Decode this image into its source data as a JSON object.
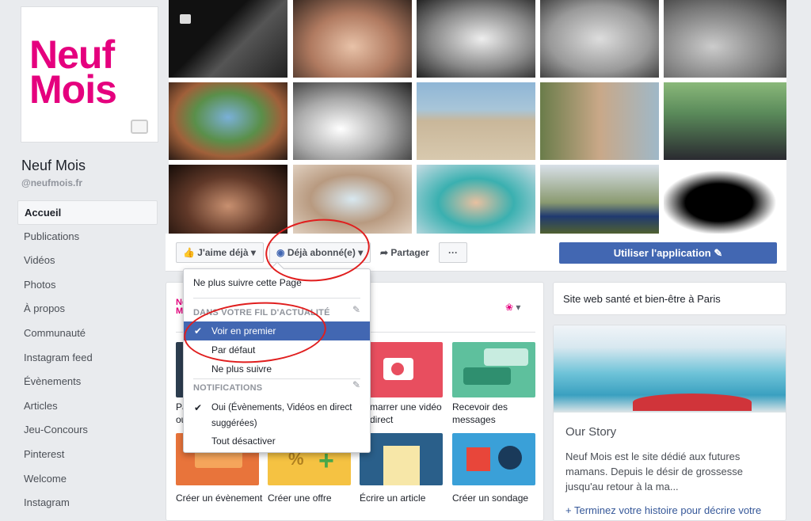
{
  "page": {
    "name": "Neuf Mois",
    "handle": "@neufmois.fr",
    "logo_line1": "Neuf",
    "logo_line2": "Mois"
  },
  "nav": [
    "Accueil",
    "Publications",
    "Vidéos",
    "Photos",
    "À propos",
    "Communauté",
    "Instagram feed",
    "Évènements",
    "Articles",
    "Jeu-Concours",
    "Pinterest",
    "Welcome",
    "Instagram"
  ],
  "actions": {
    "like": "J'aime déjà",
    "subscribed": "Déjà abonné(e)",
    "share": "Partager",
    "more": "···",
    "use_app": "Utiliser l'application"
  },
  "dropdown": {
    "unfollow_page": "Ne plus suivre cette Page",
    "news_feed_head": "DANS VOTRE FIL D'ACTUALITÉ",
    "see_first": "Voir en premier",
    "default": "Par défaut",
    "unfollow": "Ne plus suivre",
    "notif_head": "NOTIFICATIONS",
    "notif_on_1": "Oui (Évènements, Vidéos en direct",
    "notif_on_2": "suggérées)",
    "notif_off": "Tout désactiver"
  },
  "tiles": {
    "row1": [
      "Pa…",
      "",
      "marrer une vidéo",
      "Recevoir des"
    ],
    "row1b": [
      "ou",
      "",
      "direct",
      "messages"
    ],
    "row2": [
      "Créer un évènement",
      "Créer une offre",
      "Écrire un article",
      "Créer un sondage"
    ]
  },
  "right": {
    "site": "Site web santé et bien-être à Paris",
    "story_title": "Our Story",
    "story_text": "Neuf Mois est le site dédié aux futures mamans. Depuis le désir de grossesse jusqu'au retour à la ma...",
    "story_link": "+ Terminez votre histoire pour décrire votre entreprise aux gens"
  },
  "colors": {
    "accent": "#4267b2",
    "brand": "#e5007e",
    "highlight": "#4267b2",
    "annotation": "#e01e1e"
  }
}
